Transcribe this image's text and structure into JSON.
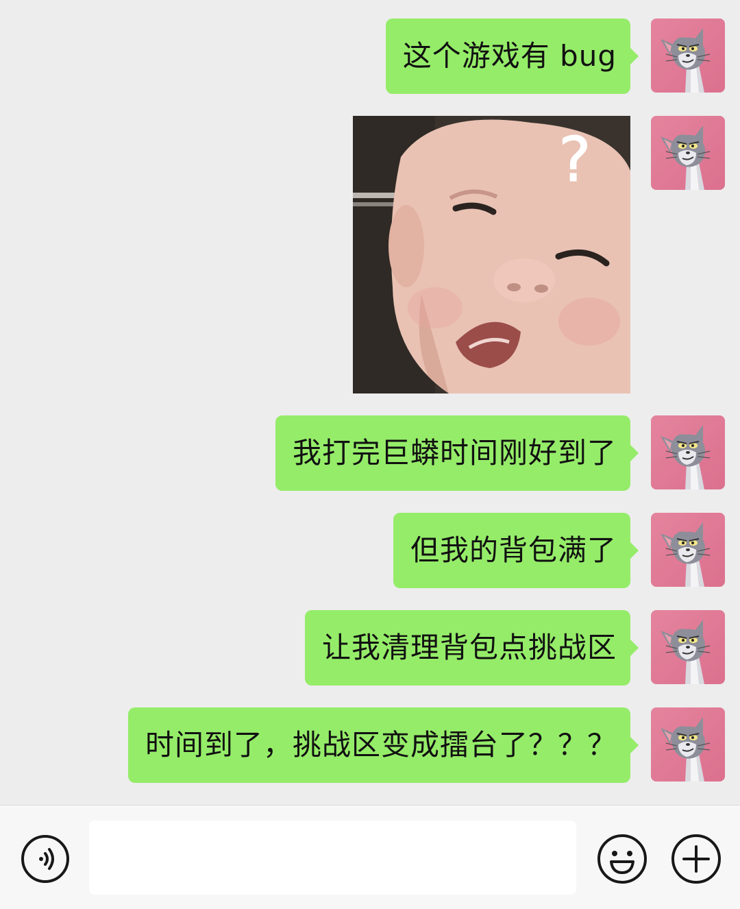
{
  "messages": [
    {
      "type": "text",
      "text": "这个游戏有 bug"
    },
    {
      "type": "sticker",
      "sticker": "confused-baby-question-mark"
    },
    {
      "type": "text",
      "text": "我打完巨蟒时间刚好到了"
    },
    {
      "type": "text",
      "text": "但我的背包满了"
    },
    {
      "type": "text",
      "text": "让我清理背包点挑战区"
    },
    {
      "type": "text",
      "text": "时间到了，挑战区变成擂台了？？？"
    }
  ],
  "sticker_text": "?",
  "avatar": "tom-cat-avatar",
  "input": {
    "value": "",
    "placeholder": ""
  },
  "icons": {
    "voice": "voice-icon",
    "emoji": "emoji-icon",
    "plus": "plus-icon"
  },
  "colors": {
    "background": "#ededed",
    "bubble": "#95ec69",
    "avatar_bg": "#e07a96",
    "input_bar": "#f7f7f7"
  }
}
